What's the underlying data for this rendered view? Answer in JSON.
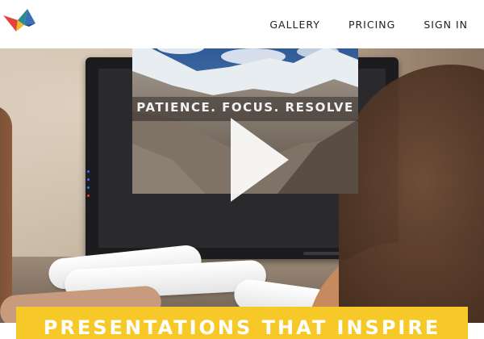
{
  "header": {
    "logo_icon": "origami-bird-icon",
    "nav": [
      {
        "label": "GALLERY"
      },
      {
        "label": "PRICING"
      },
      {
        "label": "SIGN IN"
      }
    ]
  },
  "hero": {
    "video": {
      "caption": "PATIENCE. FOCUS. RESOLVE",
      "play_icon": "play-icon"
    },
    "banner": {
      "text": "PRESENTATIONS THAT INSPIRE"
    }
  },
  "colors": {
    "banner": "#f7c928",
    "nav_text": "#222222",
    "logo_red": "#e2433a",
    "logo_yellow": "#f2b928",
    "logo_teal": "#2a8c8c",
    "logo_blue": "#3b6fb5"
  }
}
